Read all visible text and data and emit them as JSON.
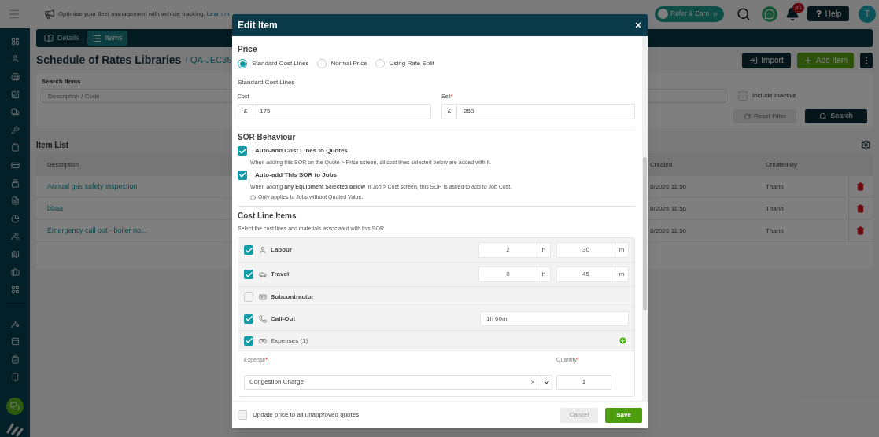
{
  "top_bar": {
    "announcement": "Optimise your fleet management with vehicle tracking.",
    "link": "Learn m",
    "refer_button": "Refer & Earn",
    "notification_count": "31",
    "help_button": "Help",
    "avatar": "T"
  },
  "tabs": [
    {
      "label": "Details",
      "selected": false
    },
    {
      "label": "Items",
      "selected": true
    }
  ],
  "page": {
    "title": "Schedule of Rates Libraries",
    "breadcrumb_separator": "/",
    "breadcrumb": "QA-JEC36",
    "import_button": "Import",
    "add_button": "Add Item"
  },
  "search": {
    "label": "Search Items",
    "placeholder": "Description / Code",
    "include_inactive": {
      "label": "Include Inactive",
      "checked": false
    },
    "reset_button": "Reset Filter",
    "search_button": "Search"
  },
  "item_list": {
    "title": "Item List",
    "columns": [
      "Description",
      "Created",
      "Created By"
    ],
    "rows": [
      {
        "description": "Annual gas safety inspection",
        "created": "8/2026 11:56",
        "created_by": "Thanh"
      },
      {
        "description": "bbaa",
        "created": "8/2026 11:56",
        "created_by": "Thanh"
      },
      {
        "description": "Emergency call out - boiler no...",
        "created": "8/2026 11:56",
        "created_by": "Thanh"
      }
    ]
  },
  "modal": {
    "title": "Edit Item",
    "price": {
      "heading": "Price",
      "options": [
        {
          "label": "Standard Cost Lines",
          "selected": true
        },
        {
          "label": "Normal Price",
          "selected": false
        },
        {
          "label": "Using Rate Split",
          "selected": false
        }
      ]
    },
    "cost_lines_heading": "Standard Cost Lines",
    "cost": {
      "label": "Cost",
      "currency": "£",
      "value": "175"
    },
    "sell": {
      "label": "Sell",
      "required_mark": "*",
      "currency": "£",
      "value": "250"
    },
    "behaviour": {
      "heading": "SOR Behaviour",
      "options": [
        {
          "label": "Auto-add Cost Lines to Quotes",
          "checked": true,
          "description": "When adding this SOR on the Quote > Price screen, all cost lines selected below are added with it."
        },
        {
          "label": "Auto-add This SOR to Jobs",
          "checked": true,
          "description": "When adding **any Equipment Selected below** in Job > Cost screen, this SOR is asked to add to Job Cost.",
          "note": "Only applies to Jobs without Quoted Value."
        }
      ]
    },
    "cost_line_items": {
      "heading": "Cost Line Items",
      "subtitle": "Select the cost lines and materials associated with this SOR",
      "lines": [
        {
          "kind": "duration",
          "label": "Labour",
          "checked": true,
          "hours": "2",
          "hours_unit": "h",
          "minutes": "30",
          "minutes_unit": "m"
        },
        {
          "kind": "duration",
          "label": "Travel",
          "checked": true,
          "hours": "0",
          "hours_unit": "h",
          "minutes": "45",
          "minutes_unit": "m"
        },
        {
          "kind": "plain",
          "label": "Subcontractor",
          "checked": false
        },
        {
          "kind": "text",
          "label": "Call-Out",
          "checked": true,
          "value": "1h 00m"
        },
        {
          "kind": "expenses",
          "label": "Expenses",
          "count": "(1)",
          "checked": true,
          "expense_label": "Expense",
          "quantity_label": "Quantity",
          "required_mark": "*",
          "expense_value": "Congestion Charge",
          "quantity_value": "1"
        }
      ]
    },
    "footer": {
      "update_quotes": {
        "label": "Update price to all unapproved quotes",
        "checked": false
      },
      "cancel_button": "Cancel",
      "save_button": "Save"
    }
  }
}
